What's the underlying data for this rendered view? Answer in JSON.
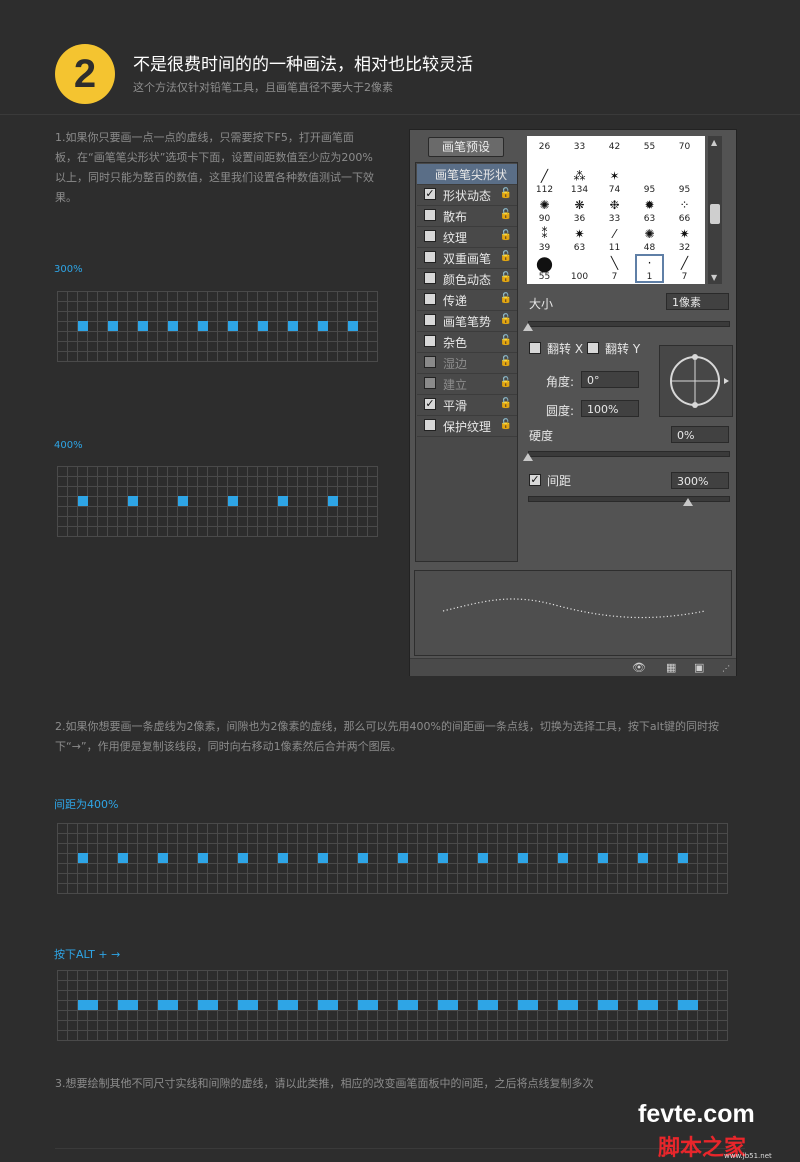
{
  "header": {
    "number": "2",
    "title": "不是很费时间的的一种画法，相对也比较灵活",
    "subtitle": "这个方法仅针对铅笔工具，且画笔直径不要大于2像素"
  },
  "para1": "1.如果你只要画一点一点的虚线，只需要按下F5，打开画笔面板，在“画笔笔尖形状”选项卡下面，设置间距数值至少应为200%以上，同时只能为整百的数值，这里我们设置各种数值测试一下效果。",
  "label300": "300%",
  "label400": "400%",
  "para2": "2.如果你想要画一条虚线为2像素，间隙也为2像素的虚线，那么可以先用400%的间距画一条点线，切换为选择工具，按下alt键的同时按下“→”，作用便是复制该线段，同时向右移动1像素然后合并两个图层。",
  "label_spacing400": "间距为400%",
  "label_alt": "按下ALT + →",
  "para3": "3.想要绘制其他不同尺寸实线和间隙的虚线，请以此类推，相应的改变画笔面板中的间距，之后将点线复制多次",
  "panel": {
    "preset_button": "画笔预设",
    "list": [
      {
        "label": "画笔笔尖形状",
        "selected": true,
        "checkbox": false
      },
      {
        "label": "形状动态",
        "checked": true
      },
      {
        "label": "散布",
        "checked": false
      },
      {
        "label": "纹理",
        "checked": false
      },
      {
        "label": "双重画笔",
        "checked": false
      },
      {
        "label": "颜色动态",
        "checked": false
      },
      {
        "label": "传递",
        "checked": false
      },
      {
        "label": "画笔笔势",
        "checked": false
      },
      {
        "label": "杂色",
        "checked": false
      },
      {
        "label": "湿边",
        "checked": false,
        "disabled": true
      },
      {
        "label": "建立",
        "checked": false,
        "disabled": true
      },
      {
        "label": "平滑",
        "checked": true
      },
      {
        "label": "保护纹理",
        "checked": false
      }
    ],
    "brush_sizes": [
      "26",
      "33",
      "42",
      "55",
      "70",
      "112",
      "134",
      "74",
      "95",
      "95",
      "90",
      "36",
      "33",
      "63",
      "66",
      "39",
      "63",
      "11",
      "48",
      "32",
      "55",
      "100",
      "7",
      "1",
      "7"
    ],
    "size_label": "大小",
    "size_value": "1像素",
    "flip_x": "翻转 X",
    "flip_y": "翻转 Y",
    "angle_label": "角度:",
    "angle_value": "0°",
    "roundness_label": "圆度:",
    "roundness_value": "100%",
    "hardness_label": "硬度",
    "hardness_value": "0%",
    "spacing_label": "间距",
    "spacing_value": "300%",
    "spacing_checked": true
  },
  "watermark": {
    "top": "fevte.com",
    "cn": "脚本之家",
    "url": "www.jb51.net"
  }
}
